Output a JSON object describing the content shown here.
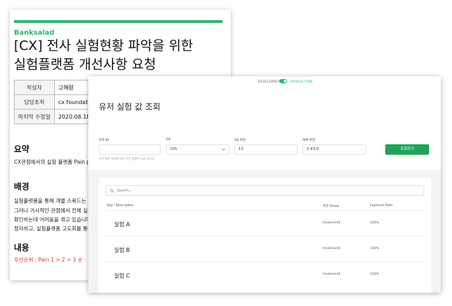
{
  "colors": {
    "accent_green": "#2bb673",
    "submit_green": "#1fa35a",
    "priority_red": "#e03131"
  },
  "document": {
    "brand": "Banksalad",
    "title_line1": "[CX] 전사 실험현황 파악을 위한",
    "title_line2": "실험플랫폼 개선사항 요청",
    "meta": [
      {
        "key": "작성자",
        "value": "고혜령"
      },
      {
        "key": "담당조직",
        "value": "cx foundation"
      },
      {
        "key": "마지막 수정일",
        "value": "2020.08.18"
      }
    ],
    "summary_heading": "요약",
    "summary_text": "CX관점에서의 실험 플랫폼 Pain poi",
    "background_heading": "배경",
    "background_lines": [
      "실험플랫폼을 통해 개별 스쿼드는 보다",
      "그러나 거시적인 관점에서 전체 실험 현",
      "확인하는데 어려움을 겪고 있습니다. 이",
      "정리하고, 실험플랫폼 고도화를 통해 해"
    ],
    "content_heading": "내용",
    "content_priority": "우선순위 :  Pain 1 > 2 > 3 순"
  },
  "app": {
    "env": {
      "dev_label": "DEVELOPMENT",
      "prod_label": "PRODUCTION"
    },
    "title": "유저 실험 값 조회",
    "form": {
      "user_id_label": "유저 ID",
      "user_id_value": "",
      "user_id_hint": "유저 ID만 입력한 경우 모든 실험만 노출 됩니다.",
      "os_label": "OS",
      "os_value": "iOS",
      "os_version_label": "OS 버전",
      "os_version_value": "13",
      "app_version_label": "APP 버전",
      "app_version_value": "2.43.0",
      "submit_label": "조회하기"
    },
    "search_placeholder": "Search...",
    "table": {
      "headers": [
        "Key / Description",
        "속한 Group",
        "Exposure Rate"
      ],
      "rows": [
        {
          "name": "실험 A",
          "group": "treatment0",
          "rate": "100%"
        },
        {
          "name": "실험 B",
          "group": "treatment0",
          "rate": "100%"
        },
        {
          "name": "실험 C",
          "group": "treatment0",
          "rate": "100%"
        }
      ]
    }
  }
}
